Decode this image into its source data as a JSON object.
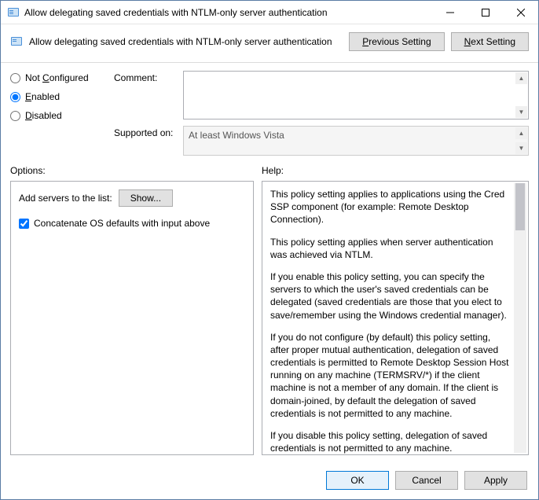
{
  "window": {
    "title": "Allow delegating saved credentials with NTLM-only server authentication"
  },
  "header": {
    "title": "Allow delegating saved credentials with NTLM-only server authentication",
    "previous_label": "Previous Setting",
    "previous_key": "P",
    "next_label": "Next Setting",
    "next_key": "N"
  },
  "config": {
    "not_configured_label": "Not Configured",
    "not_configured_key": "C",
    "enabled_label": "Enabled",
    "enabled_key": "E",
    "disabled_label": "Disabled",
    "disabled_key": "D",
    "selected": "enabled",
    "comment_label": "Comment:",
    "comment_value": "",
    "supported_label": "Supported on:",
    "supported_value": "At least Windows Vista"
  },
  "options_label": "Options:",
  "help_label": "Help:",
  "options": {
    "add_servers_label": "Add servers to the list:",
    "show_label": "Show...",
    "concat_label": "Concatenate OS defaults with input above",
    "concat_checked": true
  },
  "help": {
    "p1": "This policy setting applies to applications using the Cred SSP component (for example: Remote Desktop Connection).",
    "p2": "This policy setting applies when server authentication was achieved via NTLM.",
    "p3": "If you enable this policy setting, you can specify the servers to which the user's saved credentials can be delegated (saved credentials are those that you elect to save/remember using the Windows credential manager).",
    "p4": "If you do not configure (by default) this policy setting, after proper mutual authentication, delegation of saved credentials is permitted to Remote Desktop Session Host running on any machine (TERMSRV/*) if the client machine is not a member of any domain. If the client is domain-joined, by default the delegation of saved credentials is not permitted to any machine.",
    "p5": "If you disable this policy setting, delegation of saved credentials is not permitted to any machine."
  },
  "footer": {
    "ok": "OK",
    "cancel": "Cancel",
    "apply": "Apply"
  }
}
